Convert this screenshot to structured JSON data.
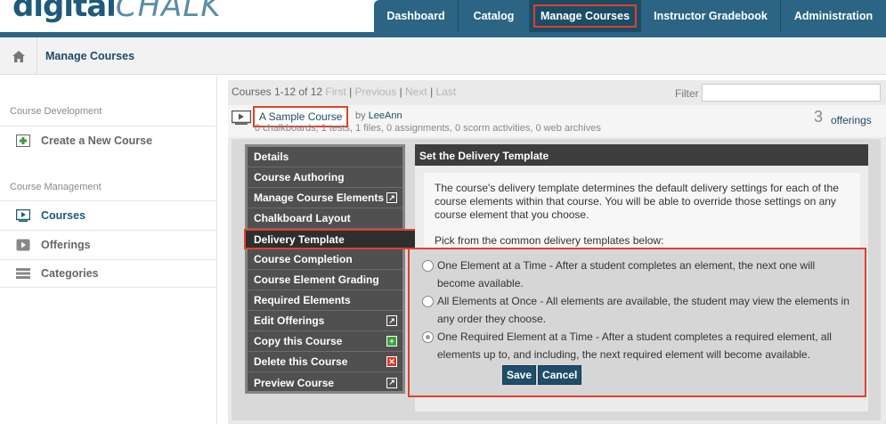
{
  "brand": {
    "logo_main": "digital",
    "logo_accent": "CHALK"
  },
  "topnav": {
    "tabs": [
      {
        "label": "Dashboard"
      },
      {
        "label": "Catalog"
      },
      {
        "label": "Manage Courses"
      },
      {
        "label": "Instructor Gradebook"
      },
      {
        "label": "Administration"
      }
    ]
  },
  "breadcrumb": {
    "title": "Manage Courses"
  },
  "sidebar": {
    "course_development_heading": "Course Development",
    "create_course_label": "Create a New Course",
    "course_management_heading": "Course Management",
    "items": [
      {
        "label": "Courses"
      },
      {
        "label": "Offerings"
      },
      {
        "label": "Categories"
      }
    ]
  },
  "pager": {
    "summary": "Courses 1-12 of 12",
    "first": "First",
    "previous": "Previous",
    "next": "Next",
    "last": "Last",
    "sep": "|"
  },
  "filter": {
    "label": "Filter",
    "value": ""
  },
  "course": {
    "name": "A Sample Course",
    "by_prefix": "by",
    "author": "LeeAnn",
    "stats": "0 chalkboards, 1 tests, 1 files, 0 assignments, 0 scorm activities, 0 web archives",
    "offerings_count": "3",
    "offerings_label": "offerings"
  },
  "course_menu": {
    "items": [
      {
        "label": "Details"
      },
      {
        "label": "Course Authoring"
      },
      {
        "label": "Manage Course Elements"
      },
      {
        "label": "Chalkboard Layout"
      },
      {
        "label": "Delivery Template"
      },
      {
        "label": "Course Completion"
      },
      {
        "label": "Course Element Grading"
      },
      {
        "label": "Required Elements"
      },
      {
        "label": "Edit Offerings"
      },
      {
        "label": "Copy this Course"
      },
      {
        "label": "Delete this Course"
      },
      {
        "label": "Preview Course"
      }
    ]
  },
  "delivery": {
    "title": "Set the Delivery Template",
    "description": "The course's delivery template determines the default delivery settings for each of the course elements within that course. You will be able to override those settings on any course element that you choose.",
    "prompt": "Pick from the common delivery templates below:",
    "options": [
      {
        "label": "One Element at a Time - After a student completes an element, the next one will become available.",
        "checked": false
      },
      {
        "label": "All Elements at Once - All elements are available, the student may view the elements in any order they choose.",
        "checked": false
      },
      {
        "label": "One Required Element at a Time - After a student completes a required element, all elements up to, and including, the next required element will become available.",
        "checked": true
      }
    ],
    "save_label": "Save",
    "cancel_label": "Cancel"
  },
  "colors": {
    "nav_blue": "#2b6583",
    "highlight_red": "#e0412a",
    "menu_dark": "#505050"
  }
}
